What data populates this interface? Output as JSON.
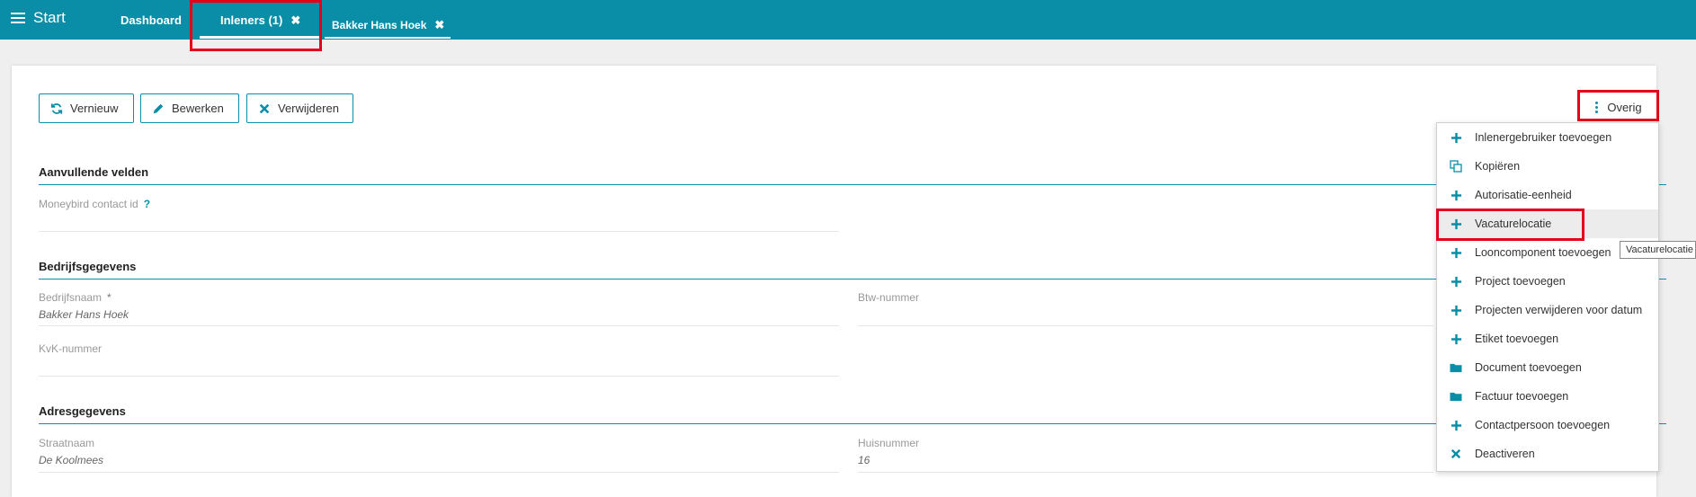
{
  "topbar": {
    "start_label": "Start",
    "tabs": [
      {
        "label": "Dashboard"
      },
      {
        "label": "Inleners (1)",
        "close": "✖"
      },
      {
        "label": "Bakker Hans Hoek",
        "close": "✖"
      }
    ]
  },
  "toolbar": {
    "refresh_label": "Vernieuw",
    "edit_label": "Bewerken",
    "delete_label": "Verwijderen",
    "more_label": "Overig"
  },
  "sections": {
    "extra": {
      "title": "Aanvullende velden",
      "moneybird_label": "Moneybird contact id",
      "moneybird_help": "?"
    },
    "company": {
      "title": "Bedrijfsgegevens",
      "name_label": "Bedrijfsnaam",
      "name_required": "*",
      "name_value": "Bakker Hans Hoek",
      "vat_label": "Btw-nummer",
      "kvk_label": "KvK-nummer"
    },
    "address": {
      "title": "Adresgegevens",
      "street_label": "Straatnaam",
      "street_value": "De Koolmees",
      "number_label": "Huisnummer",
      "number_value": "16"
    }
  },
  "menu": {
    "items": [
      {
        "label": "Inlenergebruiker toevoegen",
        "icon": "plus-icon"
      },
      {
        "label": "Kopiëren",
        "icon": "copy-icon"
      },
      {
        "label": "Autorisatie-eenheid",
        "icon": "plus-icon"
      },
      {
        "label": "Vacaturelocatie",
        "icon": "plus-icon"
      },
      {
        "label": "Looncomponent toevoegen",
        "icon": "plus-icon"
      },
      {
        "label": "Project toevoegen",
        "icon": "plus-icon"
      },
      {
        "label": "Projecten verwijderen voor datum",
        "icon": "plus-icon"
      },
      {
        "label": "Etiket toevoegen",
        "icon": "plus-icon"
      },
      {
        "label": "Document toevoegen",
        "icon": "folder-icon"
      },
      {
        "label": "Factuur toevoegen",
        "icon": "folder-icon"
      },
      {
        "label": "Contactpersoon toevoegen",
        "icon": "plus-icon"
      },
      {
        "label": "Deactiveren",
        "icon": "x-icon"
      }
    ],
    "tooltip": "Vacaturelocatie"
  },
  "colors": {
    "accent": "#0a8ea8",
    "highlight": "#e3001b"
  }
}
